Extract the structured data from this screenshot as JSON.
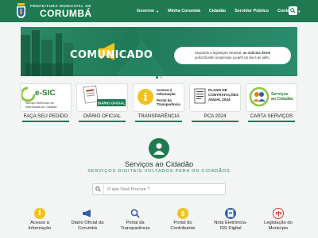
{
  "header": {
    "brand_small": "PREFEITURA MUNICIPAL DE",
    "brand_big": "CORUMBÁ",
    "nav": [
      {
        "label": "Governo",
        "dropdown": true
      },
      {
        "label": "Minha Corumbá",
        "dropdown": false
      },
      {
        "label": "Cidadão",
        "dropdown": false
      },
      {
        "label": "Servidor Público",
        "dropdown": false
      },
      {
        "label": "Contatos",
        "dropdown": true
      }
    ]
  },
  "banner": {
    "title": "COMUNICADO",
    "note_line1_prefix": "Seguindo a legislação eleitoral, ",
    "note_line1_bold": "as notícias deste",
    "note_line2": "portal ficarão suspensas a partir do dia 6 de julho."
  },
  "cards": [
    {
      "label": "FAÇA SEU PEDIDO",
      "box_title": "e-SIC",
      "box_sub1": "Serviço Eletrônico de",
      "box_sub2": "Informação ao Cidadão"
    },
    {
      "label": "DIÁRIO OFICIAL",
      "box_title": "DIÁRIO OFICIAL"
    },
    {
      "label": "TRANSPARÊNCIA",
      "box_title1": "Acesso à",
      "box_title2": "Informação",
      "box_title3": "Portal da",
      "box_title4": "Transparência"
    },
    {
      "label": "PCA 2024",
      "box_title1": "PLANO DE",
      "box_title2": "CONTRATAÇÕES",
      "box_title3": "ANUAL 2024"
    },
    {
      "label": "CARTA SERVIÇOS",
      "box_title1": "Serviços",
      "box_title2": "ao Cidadão"
    }
  ],
  "servicos": {
    "title": "Serviços ao Cidadão",
    "subtitle": "SERVIÇOS DIGITAIS VOLTADOS PARA OS CIDADÃOS",
    "search_placeholder": "O que Você Procura ?"
  },
  "services": [
    {
      "line1": "Acesso à",
      "line2": "Informação",
      "color": "#f2c21b"
    },
    {
      "line1": "Diário Oficial da",
      "line2": "Corumbá",
      "color": "#2d5fb3"
    },
    {
      "line1": "Portal da",
      "line2": "Transparência",
      "color": "#2d5fb3"
    },
    {
      "line1": "Portal do",
      "line2": "Contribuinte",
      "color": "#f2c21b"
    },
    {
      "line1": "Nota Eletrônica-",
      "line2": "ISS Digital",
      "color": "#2d5fb3"
    },
    {
      "line1": "Legislação do",
      "line2": "Município",
      "color": "#c0392b"
    }
  ],
  "colors": {
    "brand_green": "#1f7a52",
    "dark_green": "#1a6a4a"
  }
}
